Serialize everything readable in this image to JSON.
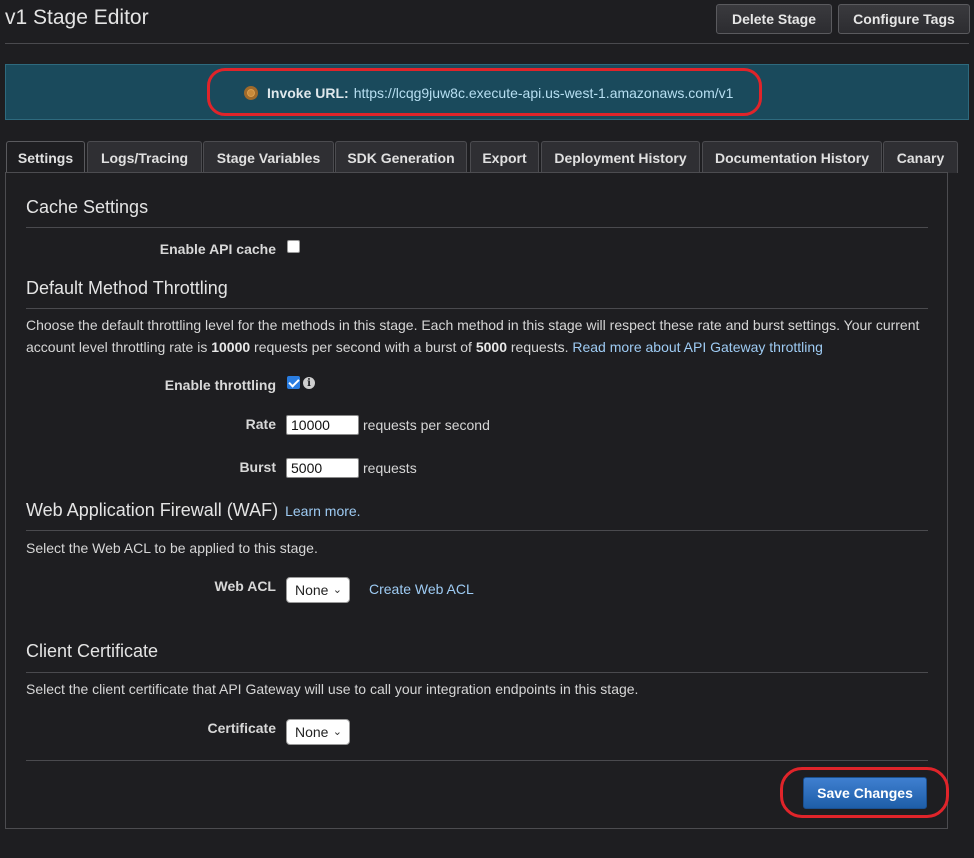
{
  "header": {
    "title": "v1 Stage Editor",
    "delete_label": "Delete Stage",
    "tags_label": "Configure Tags"
  },
  "invoke": {
    "label": "Invoke URL:",
    "url": "https://lcqg9juw8c.execute-api.us-west-1.amazonaws.com/v1"
  },
  "tabs": [
    {
      "label": "Settings",
      "active": true
    },
    {
      "label": "Logs/Tracing"
    },
    {
      "label": "Stage Variables"
    },
    {
      "label": "SDK Generation"
    },
    {
      "label": "Export"
    },
    {
      "label": "Deployment History"
    },
    {
      "label": "Documentation History"
    },
    {
      "label": "Canary"
    }
  ],
  "cache": {
    "heading": "Cache Settings",
    "enable_label": "Enable API cache",
    "enabled": false
  },
  "throttling": {
    "heading": "Default Method Throttling",
    "desc_1": "Choose the default throttling level for the methods in this stage. Each method in this stage will respect these rate and burst settings. Your current account level throttling rate is ",
    "rate_value_bold": "10000",
    "desc_2": " requests per second with a burst of ",
    "burst_value_bold": "5000",
    "desc_3": " requests. ",
    "read_more": "Read more about API Gateway throttling",
    "enable_label": "Enable throttling",
    "enabled": true,
    "rate_label": "Rate",
    "rate_value": "10000",
    "rate_unit": "requests per second",
    "burst_label": "Burst",
    "burst_value": "5000",
    "burst_unit": "requests"
  },
  "waf": {
    "heading": "Web Application Firewall (WAF)",
    "learn_more": "Learn more.",
    "desc": "Select the Web ACL to be applied to this stage.",
    "acl_label": "Web ACL",
    "acl_value": "None",
    "create_link": "Create Web ACL"
  },
  "cert": {
    "heading": "Client Certificate",
    "desc": "Select the client certificate that API Gateway will use to call your integration endpoints in this stage.",
    "label": "Certificate",
    "value": "None"
  },
  "save_label": "Save Changes",
  "colors": {
    "accent": "#2a7de1",
    "invoke_bg": "#1a4a5c",
    "highlight": "#e0242a"
  }
}
